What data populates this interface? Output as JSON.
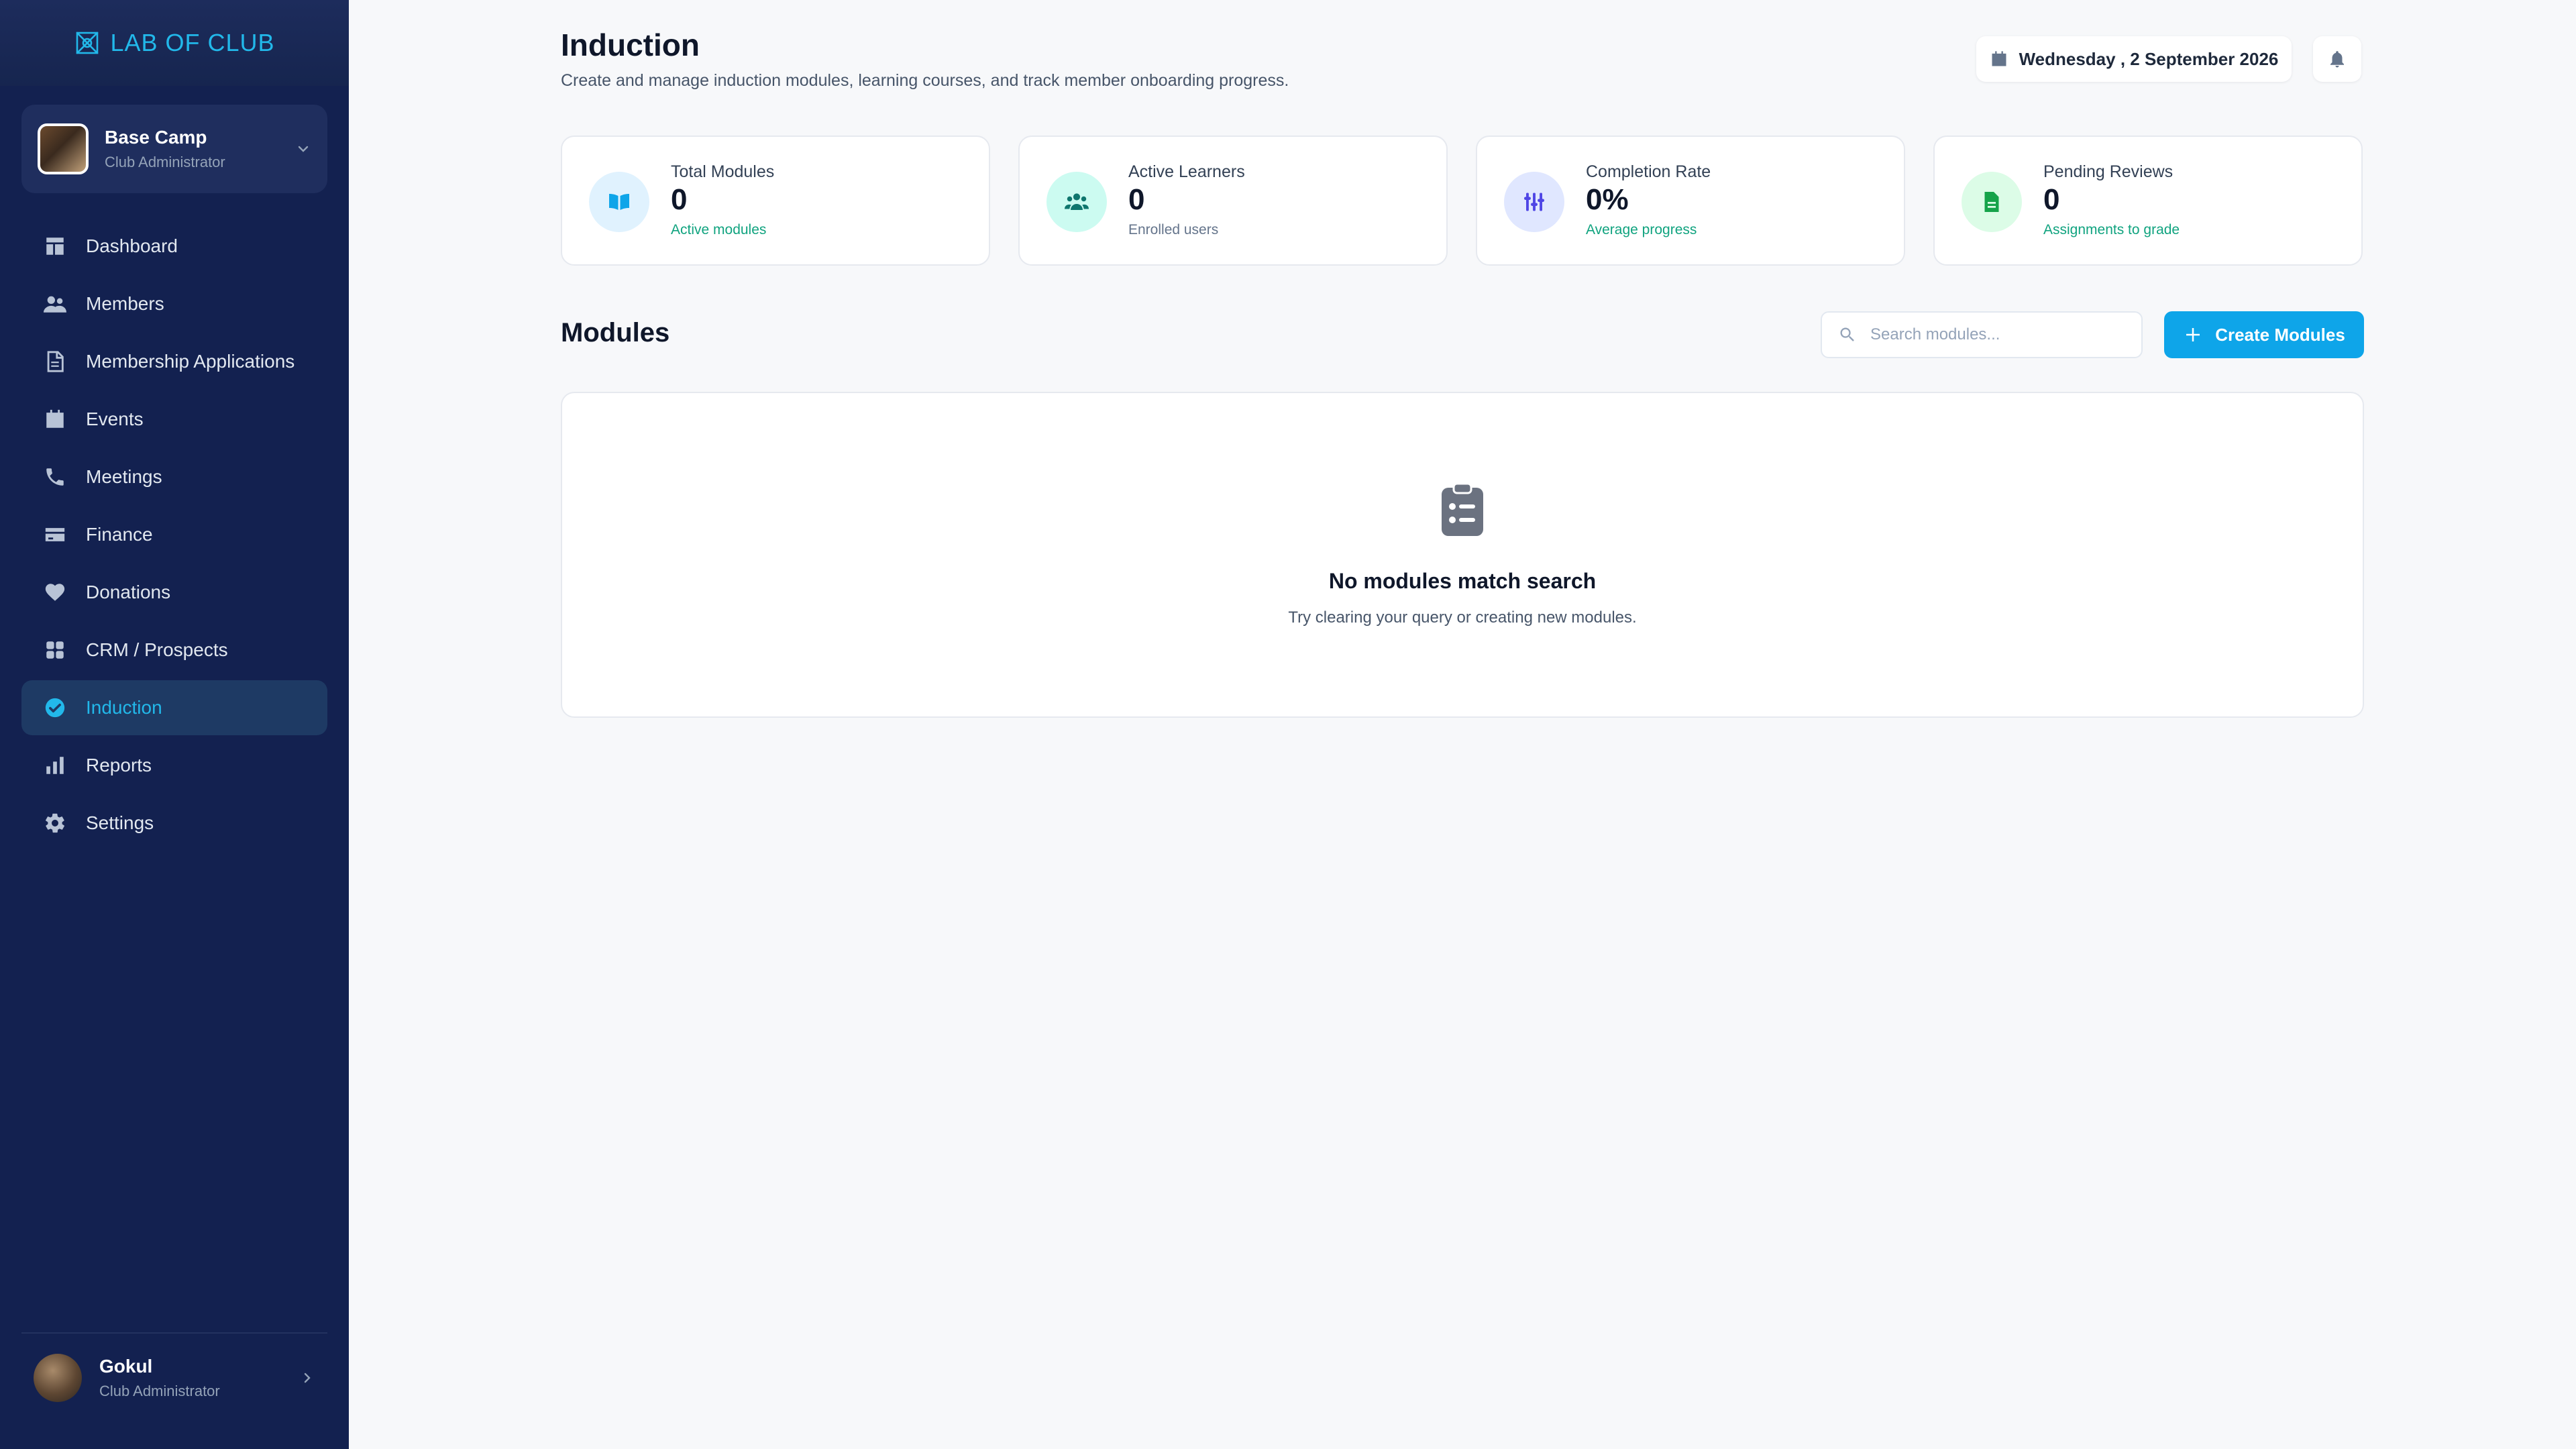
{
  "app": {
    "name": "LAB OF CLUB",
    "brand_color": "#22b8ea"
  },
  "club": {
    "name": "Base Camp",
    "role": "Club Administrator"
  },
  "sidebar": {
    "items": [
      {
        "label": "Dashboard",
        "icon": "dashboard-icon"
      },
      {
        "label": "Members",
        "icon": "users-icon"
      },
      {
        "label": "Membership Applications",
        "icon": "document-icon"
      },
      {
        "label": "Events",
        "icon": "calendar-icon"
      },
      {
        "label": "Meetings",
        "icon": "phone-icon"
      },
      {
        "label": "Finance",
        "icon": "card-icon"
      },
      {
        "label": "Donations",
        "icon": "heart-icon"
      },
      {
        "label": "CRM / Prospects",
        "icon": "grid-icon"
      },
      {
        "label": "Induction",
        "icon": "check-circle-icon",
        "active": true
      },
      {
        "label": "Reports",
        "icon": "bar-chart-icon"
      },
      {
        "label": "Settings",
        "icon": "gear-icon"
      }
    ]
  },
  "user": {
    "name": "Gokul",
    "role": "Club Administrator"
  },
  "header": {
    "title": "Induction",
    "subtitle": "Create and manage induction modules, learning courses, and track member onboarding progress.",
    "date": "Wednesday , 2 September 2026"
  },
  "stats": [
    {
      "label": "Total Modules",
      "value": "0",
      "sub": "Active modules",
      "icon": "book-icon",
      "color": "#0ea5e9"
    },
    {
      "label": "Active Learners",
      "value": "0",
      "sub": "Enrolled users",
      "icon": "users-icon",
      "color": "#14b8a6"
    },
    {
      "label": "Completion Rate",
      "value": "0%",
      "sub": "Average progress",
      "icon": "sliders-icon",
      "color": "#6366f1"
    },
    {
      "label": "Pending Reviews",
      "value": "0",
      "sub": "Assignments to grade",
      "icon": "file-icon",
      "color": "#22c55e"
    }
  ],
  "modules": {
    "title": "Modules",
    "search_placeholder": "Search modules...",
    "create_label": "Create Modules",
    "empty_title": "No modules match search",
    "empty_text": "Try clearing your query or creating new modules."
  }
}
